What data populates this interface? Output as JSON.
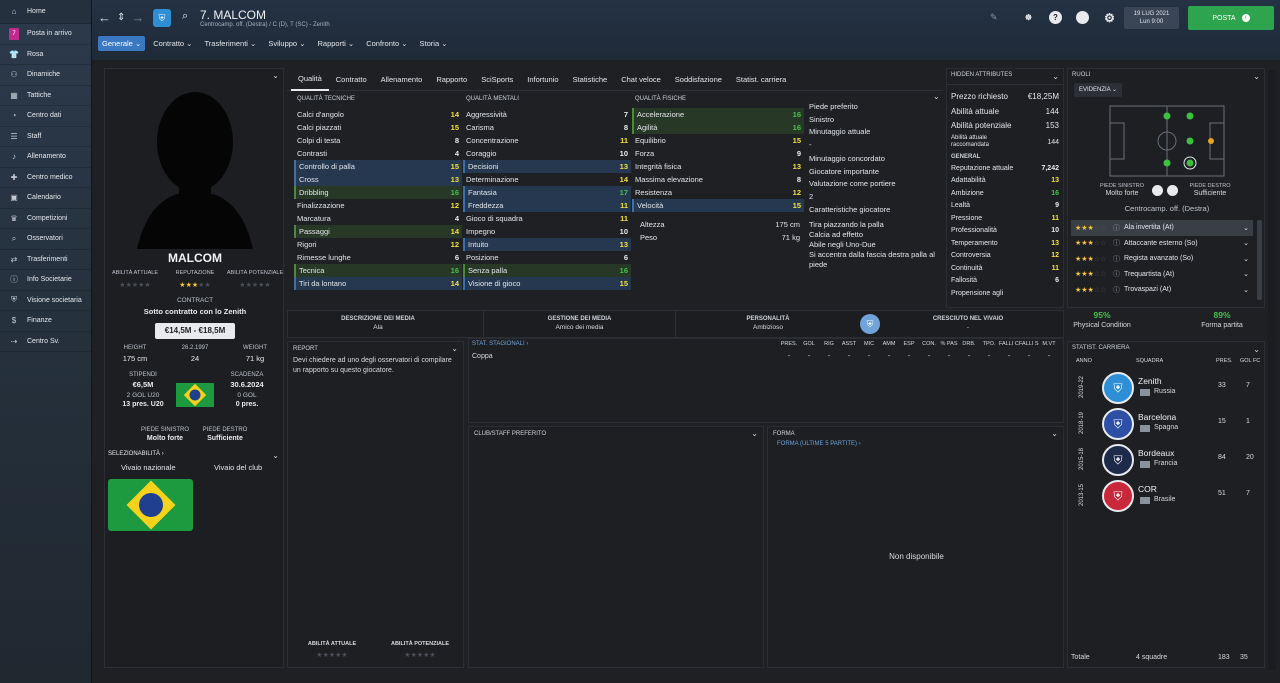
{
  "sidebar": {
    "items": [
      {
        "icon": "home-icon",
        "label": "Home"
      },
      {
        "icon": "inbox-icon",
        "label": "Posta in arrivo",
        "badge": "7"
      },
      {
        "icon": "shirt-icon",
        "label": "Rosa"
      },
      {
        "icon": "people-icon",
        "label": "Dinamiche"
      },
      {
        "icon": "tactics-icon",
        "label": "Tattiche"
      },
      {
        "icon": "chart-icon",
        "label": "Centro dati"
      },
      {
        "icon": "staff-icon",
        "label": "Staff"
      },
      {
        "icon": "whistle-icon",
        "label": "Allenamento"
      },
      {
        "icon": "medical-icon",
        "label": "Centro medico"
      },
      {
        "icon": "calendar-icon",
        "label": "Calendario"
      },
      {
        "icon": "trophy-icon",
        "label": "Competizioni"
      },
      {
        "icon": "binoculars-icon",
        "label": "Osservatori"
      },
      {
        "icon": "transfer-icon",
        "label": "Trasferimenti"
      },
      {
        "icon": "info-icon",
        "label": "Info Societarie"
      },
      {
        "icon": "club-icon",
        "label": "Visione societaria"
      },
      {
        "icon": "finance-icon",
        "label": "Finanze"
      },
      {
        "icon": "youth-icon",
        "label": "Centro Sv."
      }
    ]
  },
  "header": {
    "title": "7. MALCOM",
    "subtitle": "Centrocamp. off. (Destra) / C (D), T (SC) - Zenith",
    "date": "19 LUG 2021",
    "day": "Lun 9:00",
    "posta_label": "POSTA",
    "menu": [
      "Generale",
      "Contratto",
      "Trasferimenti",
      "Sviluppo",
      "Rapporti",
      "Confronto",
      "Storia"
    ]
  },
  "profile": {
    "name": "MALCOM",
    "labels": {
      "ability": "ABILITÀ ATTUALE",
      "reputation": "REPUTAZIONE",
      "potential": "ABILITÀ POTENZIALE"
    },
    "contract_label": "CONTRACT",
    "contract_text": "Sotto contratto con lo Zenith",
    "value_range": "€14,5M - €18,5M",
    "height_label": "HEIGHT",
    "height": "175 cm",
    "dob": "26.2.1997",
    "age": "24",
    "weight_label": "WEIGHT",
    "weight": "71 kg",
    "wage_label": "STIPENDI",
    "wage": "€6,5M",
    "goals_u20": "2 GOL U20",
    "apps_u20": "13 pres. U20",
    "expiry_label": "SCADENZA",
    "expiry": "30.6.2024",
    "goals": "0 GOL",
    "apps": "0 pres.",
    "left_foot_label": "PIEDE SINISTRO",
    "left_foot": "Molto forte",
    "right_foot_label": "PIEDE DESTRO",
    "right_foot": "Sufficiente",
    "selectability": "SELEZIONABILITÀ",
    "national": "Vivaio nazionale",
    "club": "Vivaio del club"
  },
  "tabs": [
    "Qualità",
    "Contratto",
    "Allenamento",
    "Rapporto",
    "SciSports",
    "Infortunio",
    "Statistiche",
    "Chat veloce",
    "Soddisfazione",
    "Statist. carriera"
  ],
  "technical": {
    "title": "QUALITÀ TECNICHE",
    "items": [
      {
        "name": "Calci d'angolo",
        "value": "14",
        "c": "y",
        "hl": ""
      },
      {
        "name": "Calci piazzati",
        "value": "15",
        "c": "y",
        "hl": ""
      },
      {
        "name": "Colpi di testa",
        "value": "8",
        "c": "w",
        "hl": ""
      },
      {
        "name": "Contrasti",
        "value": "4",
        "c": "w",
        "hl": ""
      },
      {
        "name": "Controllo di palla",
        "value": "15",
        "c": "y",
        "hl": "b"
      },
      {
        "name": "Cross",
        "value": "13",
        "c": "y",
        "hl": "b"
      },
      {
        "name": "Dribbling",
        "value": "16",
        "c": "g",
        "hl": "g"
      },
      {
        "name": "Finalizzazione",
        "value": "12",
        "c": "y",
        "hl": ""
      },
      {
        "name": "Marcatura",
        "value": "4",
        "c": "w",
        "hl": ""
      },
      {
        "name": "Passaggi",
        "value": "14",
        "c": "y",
        "hl": "g"
      },
      {
        "name": "Rigori",
        "value": "12",
        "c": "y",
        "hl": ""
      },
      {
        "name": "Rimesse lunghe",
        "value": "6",
        "c": "w",
        "hl": ""
      },
      {
        "name": "Tecnica",
        "value": "16",
        "c": "g",
        "hl": "g"
      },
      {
        "name": "Tiri da lontano",
        "value": "14",
        "c": "y",
        "hl": "b"
      }
    ]
  },
  "mental": {
    "title": "QUALITÀ MENTALI",
    "items": [
      {
        "name": "Aggressività",
        "value": "7",
        "c": "w",
        "hl": ""
      },
      {
        "name": "Carisma",
        "value": "8",
        "c": "w",
        "hl": ""
      },
      {
        "name": "Concentrazione",
        "value": "11",
        "c": "y",
        "hl": ""
      },
      {
        "name": "Coraggio",
        "value": "10",
        "c": "w",
        "hl": ""
      },
      {
        "name": "Decisioni",
        "value": "13",
        "c": "y",
        "hl": "b"
      },
      {
        "name": "Determinazione",
        "value": "14",
        "c": "y",
        "hl": ""
      },
      {
        "name": "Fantasia",
        "value": "17",
        "c": "g",
        "hl": "b"
      },
      {
        "name": "Freddezza",
        "value": "11",
        "c": "y",
        "hl": "b"
      },
      {
        "name": "Gioco di squadra",
        "value": "11",
        "c": "y",
        "hl": ""
      },
      {
        "name": "Impegno",
        "value": "10",
        "c": "w",
        "hl": ""
      },
      {
        "name": "Intuito",
        "value": "13",
        "c": "y",
        "hl": "b"
      },
      {
        "name": "Posizione",
        "value": "6",
        "c": "w",
        "hl": ""
      },
      {
        "name": "Senza palla",
        "value": "16",
        "c": "g",
        "hl": "g"
      },
      {
        "name": "Visione di gioco",
        "value": "15",
        "c": "y",
        "hl": "b"
      }
    ]
  },
  "physical": {
    "title": "QUALITÀ FISICHE",
    "items": [
      {
        "name": "Accelerazione",
        "value": "16",
        "c": "g",
        "hl": "g"
      },
      {
        "name": "Agilità",
        "value": "16",
        "c": "g",
        "hl": "g"
      },
      {
        "name": "Equilibrio",
        "value": "15",
        "c": "y",
        "hl": ""
      },
      {
        "name": "Forza",
        "value": "9",
        "c": "w",
        "hl": ""
      },
      {
        "name": "Integrità fisica",
        "value": "13",
        "c": "y",
        "hl": ""
      },
      {
        "name": "Massima elevazione",
        "value": "8",
        "c": "w",
        "hl": ""
      },
      {
        "name": "Resistenza",
        "value": "12",
        "c": "y",
        "hl": ""
      },
      {
        "name": "Velocità",
        "value": "15",
        "c": "y",
        "hl": "b"
      }
    ],
    "height_label": "Altezza",
    "height": "175 cm",
    "weight_label": "Peso",
    "weight": "71 kg"
  },
  "info": {
    "foot_title": "Piede preferito",
    "foot": "Sinistro",
    "min_title": "Minutaggio attuale",
    "min": "-",
    "agreed_title": "Minutaggio concordato",
    "agreed": "Giocatore importante",
    "gk_title": "Valutazione come portiere",
    "gk": "2",
    "traits_title": "Caratteristiche giocatore",
    "traits": [
      "Tira piazzando la palla",
      "Calcia ad effetto",
      "Abile negli Uno-Due",
      "Si accentra dalla fascia destra palla al piede"
    ]
  },
  "hidden": {
    "title": "HIDDEN ATTRIBUTES",
    "price_label": "Prezzo richiesto",
    "price": "€18,25M",
    "ca_label": "Abilità attuale",
    "ca": "144",
    "pa_label": "Abilità potenziale",
    "pa": "153",
    "rec_label": "Abilità attuale raccomandata",
    "rec": "144",
    "general": "GENERAL",
    "items": [
      {
        "name": "Reputazione attuale",
        "value": "7,242",
        "c": "w"
      },
      {
        "name": "Adattabilità",
        "value": "13",
        "c": "y"
      },
      {
        "name": "Ambizione",
        "value": "16",
        "c": "g"
      },
      {
        "name": "Lealtà",
        "value": "9",
        "c": "w"
      },
      {
        "name": "Pressione",
        "value": "11",
        "c": "y"
      },
      {
        "name": "Professionalità",
        "value": "10",
        "c": "w"
      },
      {
        "name": "Temperamento",
        "value": "13",
        "c": "y"
      },
      {
        "name": "Controversia",
        "value": "12",
        "c": "y"
      },
      {
        "name": "Continuità",
        "value": "11",
        "c": "y"
      },
      {
        "name": "Fallosità",
        "value": "6",
        "c": "w"
      },
      {
        "name": "Propensione agli",
        "value": "",
        "c": "w"
      }
    ]
  },
  "roles": {
    "title": "RUOLI",
    "filter": "EVIDENZIA",
    "left_foot_label": "PIEDE SINISTRO",
    "left_foot": "Molto forte",
    "right_foot_label": "PIEDE DESTRO",
    "right_foot": "Sufficiente",
    "position": "Centrocamp. off. (Destra)",
    "items": [
      {
        "stars": "★★★",
        "empty": "☆☆",
        "name": "Ala invertita (At)"
      },
      {
        "stars": "★★★",
        "empty": "☆☆",
        "name": "Attaccante esterno (So)"
      },
      {
        "stars": "★★★",
        "empty": "☆☆",
        "name": "Regista avanzato (So)"
      },
      {
        "stars": "★★★",
        "empty": "☆☆",
        "name": "Trequartista (At)"
      },
      {
        "stars": "★★★",
        "empty": "☆☆",
        "name": "Trovaspazi (At)"
      }
    ]
  },
  "conditions": {
    "physical": "95%",
    "physical_label": "Physical Condition",
    "form": "89%",
    "form_label": "Forma partita"
  },
  "media": {
    "desc_label": "DESCRIZIONE DEI MEDIA",
    "desc": "Ala",
    "handling_label": "GESTIONE DEI MEDIA",
    "handling": "Amico dei media",
    "personality_label": "PERSONALITÀ",
    "personality": "Ambizioso",
    "growth_label": "CRESCIUTO NEL VIVAIO",
    "growth": "-"
  },
  "report": {
    "title": "REPORT",
    "text": "Devi chiedere ad uno degli osservatori di compilare un rapporto su questo giocatore.",
    "ca_label": "ABILITÀ ATTUALE",
    "pa_label": "ABILITÀ POTENZIALE"
  },
  "season_stats": {
    "title": "STAT. STAGIONALI",
    "columns": [
      "PRES.",
      "GOL",
      "RIG",
      "ASST",
      "MIC",
      "AMM",
      "ESP",
      "CON.",
      "% PAS",
      "DRB.",
      "TPO.",
      "FALLI C.",
      "FALLI S.",
      "M.VT"
    ],
    "row_label": "Coppa"
  },
  "club_staff": {
    "title": "CLUB/STAFF PREFERITO"
  },
  "form": {
    "title": "FORMA",
    "subtitle": "FORMA (ULTIME 5 PARTITE)",
    "empty": "Non disponibile"
  },
  "career": {
    "title": "STATIST. CARRIERA",
    "col_year": "ANNO",
    "col_team": "SQUADRA",
    "col_apps": "PRES.",
    "col_goals": "GOL FC",
    "rows": [
      {
        "year": "2019-22",
        "team": "Zenith",
        "country": "Russia",
        "apps": "33",
        "goals": "7",
        "color": "#2f8fd6"
      },
      {
        "year": "2018-19",
        "team": "Barcelona",
        "country": "Spagna",
        "apps": "15",
        "goals": "1",
        "color": "#2d4fa6"
      },
      {
        "year": "2015-18",
        "team": "Bordeaux",
        "country": "Francia",
        "apps": "84",
        "goals": "20",
        "color": "#1e2a4a"
      },
      {
        "year": "2013-15",
        "team": "COR",
        "country": "Brasile",
        "apps": "51",
        "goals": "7",
        "color": "#c8283a"
      }
    ],
    "total_label": "Totale",
    "total_teams": "4 squadre",
    "total_apps": "183",
    "total_goals": "35"
  }
}
